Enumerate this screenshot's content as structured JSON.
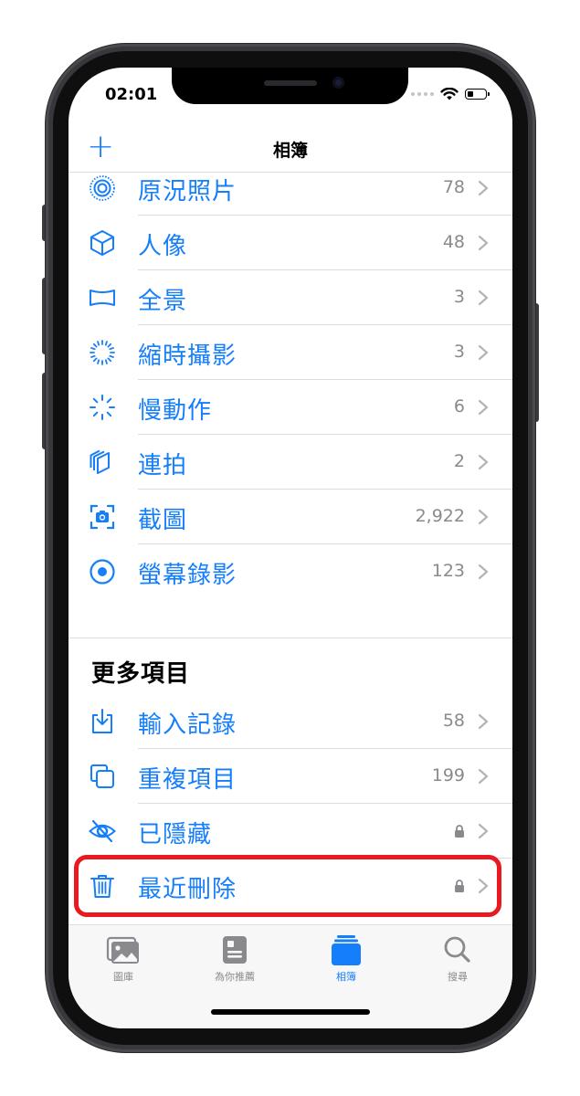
{
  "status_bar": {
    "time": "02:01"
  },
  "nav": {
    "add_label": "+",
    "title": "相簿"
  },
  "media_types": [
    {
      "label": "原況照片",
      "count": "78",
      "icon": "live-photo-icon"
    },
    {
      "label": "人像",
      "count": "48",
      "icon": "portrait-cube-icon"
    },
    {
      "label": "全景",
      "count": "3",
      "icon": "panorama-icon"
    },
    {
      "label": "縮時攝影",
      "count": "3",
      "icon": "timelapse-icon"
    },
    {
      "label": "慢動作",
      "count": "6",
      "icon": "slomo-icon"
    },
    {
      "label": "連拍",
      "count": "2",
      "icon": "burst-icon"
    },
    {
      "label": "截圖",
      "count": "2,922",
      "icon": "screenshot-icon"
    },
    {
      "label": "螢幕錄影",
      "count": "123",
      "icon": "screen-recording-icon"
    }
  ],
  "more_section": {
    "title": "更多項目",
    "items": [
      {
        "label": "輸入記錄",
        "count": "58",
        "icon": "import-icon"
      },
      {
        "label": "重複項目",
        "count": "199",
        "icon": "duplicates-icon"
      },
      {
        "label": "已隱藏",
        "icon": "hidden-eye-icon",
        "locked": true
      },
      {
        "label": "最近刪除",
        "icon": "trash-icon",
        "locked": true
      }
    ]
  },
  "tabs": [
    {
      "label": "圖庫",
      "icon": "photos-library-icon"
    },
    {
      "label": "為你推薦",
      "icon": "for-you-icon"
    },
    {
      "label": "相簿",
      "icon": "albums-icon",
      "active": true
    },
    {
      "label": "搜尋",
      "icon": "search-icon"
    }
  ],
  "colors": {
    "accent": "#157efb",
    "highlight": "#e8191f",
    "secondary_text": "#8a8a8e"
  }
}
